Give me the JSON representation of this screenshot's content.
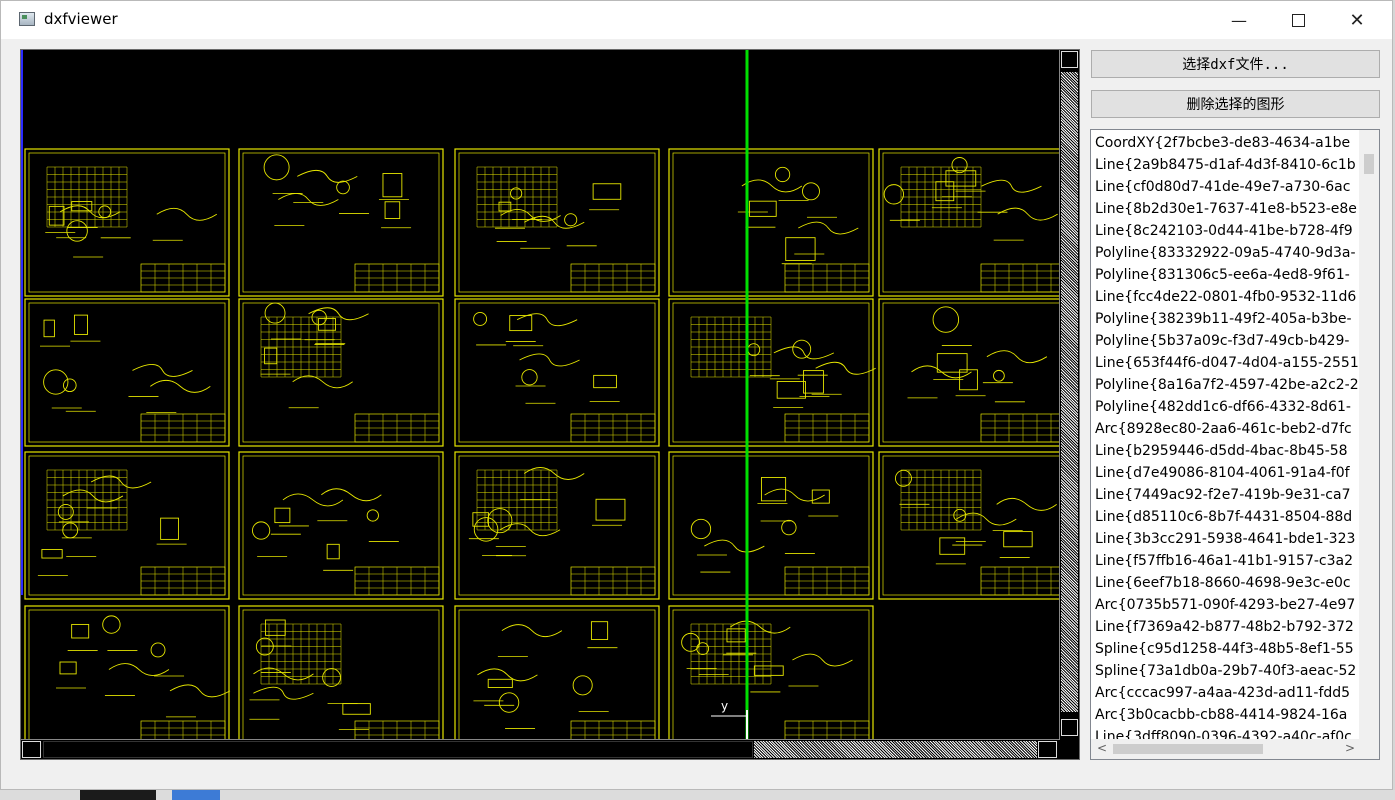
{
  "window": {
    "title": "dxfviewer",
    "minimize": "—",
    "close": "✕"
  },
  "buttons": {
    "select_file": "选择dxf文件...",
    "delete_selected": "删除选择的图形"
  },
  "canvas": {
    "axis_label": "y",
    "line_color": "#e6e600",
    "marker_color": "#00e000"
  },
  "entities": [
    "CoordXY{2f7bcbe3-de83-4634-a1be",
    "Line{2a9b8475-d1af-4d3f-8410-6c1b",
    "Line{cf0d80d7-41de-49e7-a730-6ac",
    "Line{8b2d30e1-7637-41e8-b523-e8e",
    "Line{8c242103-0d44-41be-b728-4f9",
    "Polyline{83332922-09a5-4740-9d3a-",
    "Polyline{831306c5-ee6a-4ed8-9f61-",
    "Line{fcc4de22-0801-4fb0-9532-11d6",
    "Polyline{38239b11-49f2-405a-b3be-",
    "Polyline{5b37a09c-f3d7-49cb-b429-",
    "Line{653f44f6-d047-4d04-a155-2551",
    "Polyline{8a16a7f2-4597-42be-a2c2-2",
    "Polyline{482dd1c6-df66-4332-8d61-",
    "Arc{8928ec80-2aa6-461c-beb2-d7fc",
    "Line{b2959446-d5dd-4bac-8b45-58",
    "Line{d7e49086-8104-4061-91a4-f0f",
    "Line{7449ac92-f2e7-419b-9e31-ca7",
    "Line{d85110c6-8b7f-4431-8504-88d",
    "Line{3b3cc291-5938-4641-bde1-323",
    "Line{f57ffb16-46a1-41b1-9157-c3a2",
    "Line{6eef7b18-8660-4698-9e3c-e0c",
    "Arc{0735b571-090f-4293-be27-4e97",
    "Line{f7369a42-b877-48b2-b792-372",
    "Spline{c95d1258-44f3-48b5-8ef1-55",
    "Spline{73a1db0a-29b7-40f3-aeac-52",
    "Arc{cccac997-a4aa-423d-ad11-fdd5",
    "Arc{3b0cacbb-cb88-4414-9824-16a",
    "Line{3dff8090-0396-4392-a40c-af0c"
  ]
}
